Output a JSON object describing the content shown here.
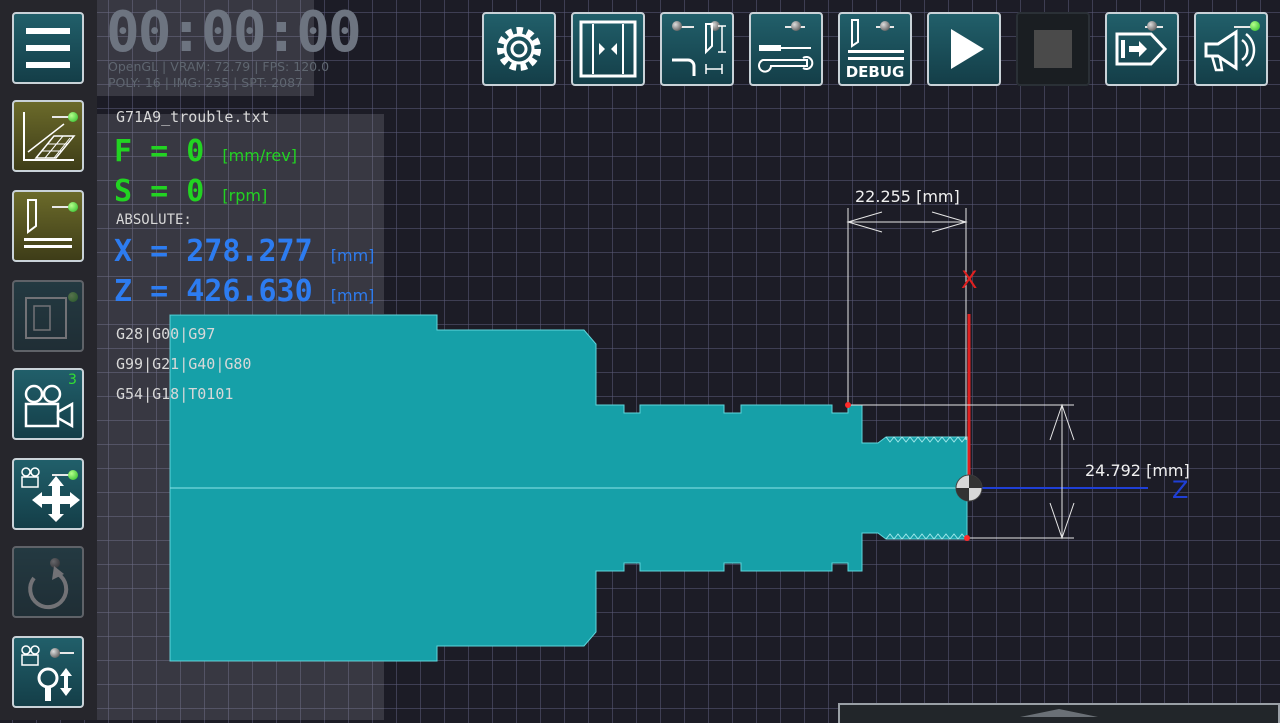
{
  "timer": "00:00:00",
  "stats": {
    "line1": "OpenGL | VRAM: 72.79 | FPS: 120.0",
    "line2": "POLY: 16 | IMG: 255 | SPT: 2087"
  },
  "program": {
    "filename": "G71A9_trouble.txt",
    "feed": {
      "label": "F = 0",
      "unit": "[mm/rev]"
    },
    "speed": {
      "label": "S = 0",
      "unit": "[rpm]"
    },
    "mode": "ABSOLUTE:",
    "x": {
      "label": "X = 278.277",
      "unit": "[mm]"
    },
    "z": {
      "label": "Z = 426.630",
      "unit": "[mm]"
    },
    "gcodes": [
      "G28|G00|G97",
      "G99|G21|G40|G80",
      "G54|G18|T0101"
    ]
  },
  "toolbar": {
    "debug_label": "DEBUG"
  },
  "sidebar": {
    "camera_count": "3"
  },
  "viewport": {
    "dim_width": "22.255 [mm]",
    "dim_diameter": "24.792 [mm]",
    "axis_x": "X",
    "axis_z": "Z"
  },
  "colors": {
    "part_fill": "#16a0a8",
    "axis_x": "#e02020",
    "axis_z": "#1f3fd6",
    "button_bg": "#1a5560"
  },
  "icons": {
    "menu": "hamburger-icon",
    "settings": "gear-icon",
    "play": "play-icon",
    "stop": "stop-icon",
    "sound": "megaphone-icon"
  }
}
